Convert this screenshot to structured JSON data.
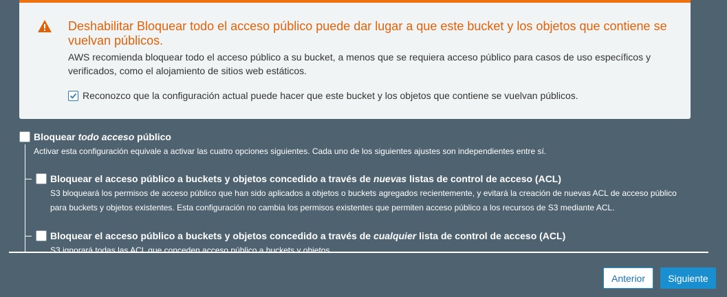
{
  "warning": {
    "title": "Deshabilitar Bloquear todo el acceso público puede dar lugar a que este bucket y los objetos que contiene se vuelvan públicos.",
    "body": "AWS recomienda bloquear todo el acceso público a su bucket, a menos que se requiera acceso público para casos de uso específicos y verificados, como el alojamiento de sitios web estáticos.",
    "ack_label": "Reconozco que la configuración actual puede hacer que este bucket y los objetos que contiene se vuelvan públicos.",
    "ack_checked": true,
    "icon": "warning-triangle-icon",
    "accent_color": "#ec7211"
  },
  "block_all": {
    "label_pre": "Bloquear ",
    "label_em": "todo acceso",
    "label_post": " público",
    "checked": false,
    "description": "Activar esta configuración equivale a activar las cuatro opciones siguientes. Cada uno de los siguientes ajustes son independientes entre sí."
  },
  "options": [
    {
      "label_pre": "Bloquear el acceso público a buckets y objetos concedido a través de ",
      "label_em": "nuevas",
      "label_post": " listas de control de acceso (ACL)",
      "checked": false,
      "description": "S3 bloqueará los permisos de acceso público que han sido aplicados a objetos o buckets agregados recientemente, y evitará la creación de nuevas ACL de acceso público para buckets y objetos existentes. Esta configuración no cambia los permisos existentes que permiten acceso público a los recursos de S3 mediante ACL."
    },
    {
      "label_pre": "Bloquear el acceso público a buckets y objetos concedido a través de ",
      "label_em": "cualquier",
      "label_post": " lista de control de acceso (ACL)",
      "checked": false,
      "description": "S3 ignorará todas las ACL que conceden acceso público a buckets y objetos."
    }
  ],
  "footer": {
    "prev_label": "Anterior",
    "next_label": "Siguiente"
  }
}
